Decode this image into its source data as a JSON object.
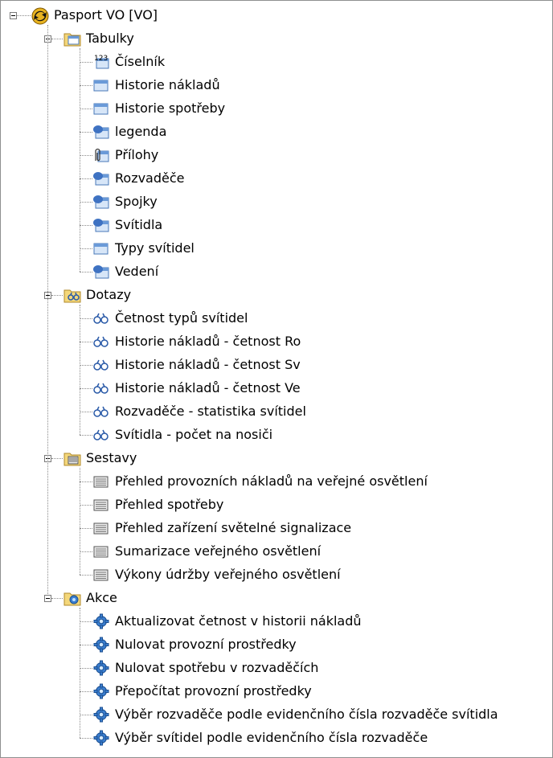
{
  "tree": {
    "root": {
      "label": "Pasport VO [VO]",
      "icon": "app-icon"
    },
    "groups": [
      {
        "label": "Tabulky",
        "icon": "tables-folder-icon",
        "items": [
          {
            "label": "Číselník",
            "icon": "numeric-table-icon"
          },
          {
            "label": "Historie nákladů",
            "icon": "table-icon"
          },
          {
            "label": "Historie spotřeby",
            "icon": "table-icon"
          },
          {
            "label": "legenda",
            "icon": "linked-table-icon"
          },
          {
            "label": "Přílohy",
            "icon": "attachment-table-icon"
          },
          {
            "label": "Rozvaděče",
            "icon": "linked-table-icon"
          },
          {
            "label": "Spojky",
            "icon": "linked-table-icon"
          },
          {
            "label": "Svítidla",
            "icon": "linked-table-icon"
          },
          {
            "label": "Typy svítidel",
            "icon": "table-icon"
          },
          {
            "label": "Vedení",
            "icon": "linked-table-icon"
          }
        ]
      },
      {
        "label": "Dotazy",
        "icon": "queries-folder-icon",
        "items": [
          {
            "label": "Četnost typů svítidel",
            "icon": "query-icon"
          },
          {
            "label": "Historie nákladů - četnost Ro",
            "icon": "query-icon"
          },
          {
            "label": "Historie nákladů - četnost Sv",
            "icon": "query-icon"
          },
          {
            "label": "Historie nákladů - četnost Ve",
            "icon": "query-icon"
          },
          {
            "label": "Rozvaděče - statistika svítidel",
            "icon": "query-icon"
          },
          {
            "label": "Svítidla - počet na nosiči",
            "icon": "query-icon"
          }
        ]
      },
      {
        "label": "Sestavy",
        "icon": "reports-folder-icon",
        "items": [
          {
            "label": "Přehled provozních nákladů na veřejné osvětlení",
            "icon": "report-icon"
          },
          {
            "label": "Přehled spotřeby",
            "icon": "report-icon"
          },
          {
            "label": "Přehled zařízení světelné signalizace",
            "icon": "report-icon"
          },
          {
            "label": "Sumarizace veřejného osvětlení",
            "icon": "report-icon"
          },
          {
            "label": "Výkony údržby veřejného osvětlení",
            "icon": "report-icon"
          }
        ]
      },
      {
        "label": "Akce",
        "icon": "actions-folder-icon",
        "items": [
          {
            "label": "Aktualizovat četnost v historii nákladů",
            "icon": "action-gear-icon"
          },
          {
            "label": "Nulovat provozní prostředky",
            "icon": "action-gear-icon"
          },
          {
            "label": "Nulovat spotřebu v rozvaděčích",
            "icon": "action-gear-icon"
          },
          {
            "label": "Přepočítat provozní prostředky",
            "icon": "action-gear-icon"
          },
          {
            "label": "Výběr rozvaděče podle evidenčního čísla rozvaděče svítidla",
            "icon": "action-gear-icon"
          },
          {
            "label": "Výběr svítidel podle evidenčního čísla rozvaděče",
            "icon": "action-gear-icon"
          }
        ]
      }
    ]
  },
  "colors": {
    "folder": "#f4d77a",
    "table_blue": "#6a9ad8",
    "gear_blue": "#3b7fd0",
    "connector": "#8a8a8a"
  }
}
